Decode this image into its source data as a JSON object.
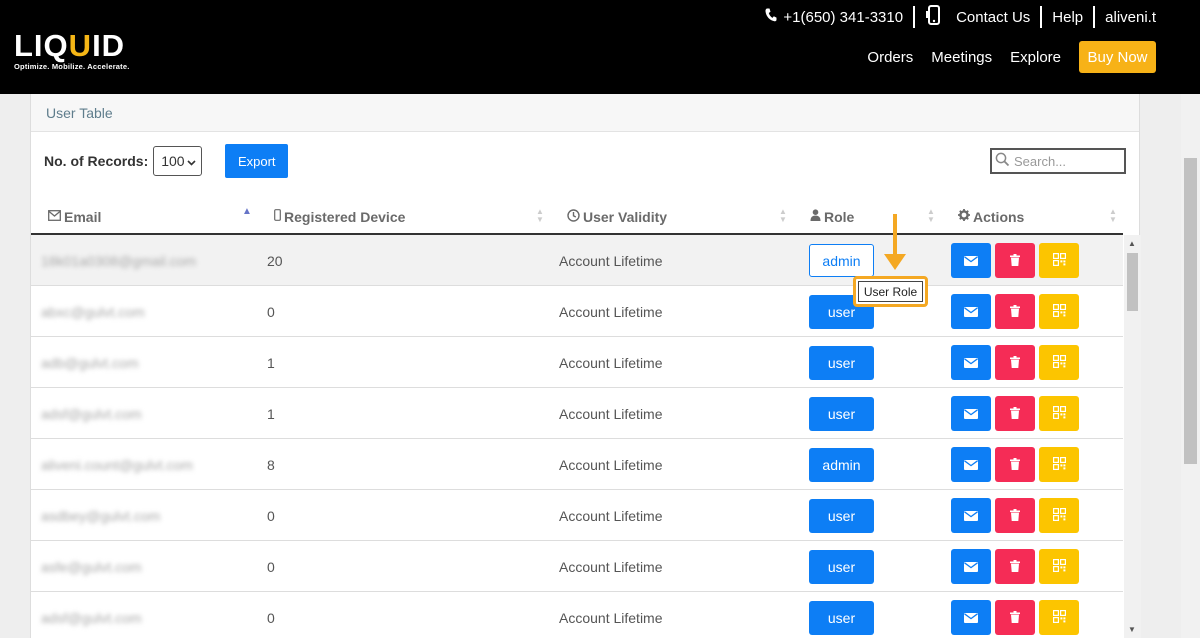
{
  "header": {
    "logo_pre": "LIQ",
    "logo_u": "U",
    "logo_post": "ID",
    "tagline": "Optimize. Mobilize. Accelerate.",
    "phone": "+1(650) 341-3310",
    "contact": "Contact Us",
    "help": "Help",
    "user": "aliveni.t",
    "nav": {
      "orders": "Orders",
      "meetings": "Meetings",
      "explore": "Explore",
      "buy_now": "Buy Now"
    }
  },
  "card": {
    "title": "User Table",
    "records_label": "No. of Records:",
    "records_value": "100",
    "export_label": "Export",
    "search_placeholder": "Search..."
  },
  "columns": {
    "email": "Email",
    "device": "Registered Device",
    "validity": "User Validity",
    "role": "Role",
    "actions": "Actions"
  },
  "rows": [
    {
      "email": "18k01a0308@gmail.com",
      "device": "20",
      "validity": "Account Lifetime",
      "role": "admin"
    },
    {
      "email": "abxc@gulvt.com",
      "device": "0",
      "validity": "Account Lifetime",
      "role": "user"
    },
    {
      "email": "adb@gulvt.com",
      "device": "1",
      "validity": "Account Lifetime",
      "role": "user"
    },
    {
      "email": "adsf@gulvt.com",
      "device": "1",
      "validity": "Account Lifetime",
      "role": "user"
    },
    {
      "email": "aliveni.count@gulvt.com",
      "device": "8",
      "validity": "Account Lifetime",
      "role": "admin"
    },
    {
      "email": "asdbey@gulvt.com",
      "device": "0",
      "validity": "Account Lifetime",
      "role": "user"
    },
    {
      "email": "asfe@gulvt.com",
      "device": "0",
      "validity": "Account Lifetime",
      "role": "user"
    },
    {
      "email": "adsf@gulvt.com",
      "device": "0",
      "validity": "Account Lifetime",
      "role": "user"
    }
  ],
  "tooltip": "User Role",
  "colors": {
    "primary": "#0d7ef5",
    "danger": "#f52c56",
    "warning": "#fcc500",
    "brand_yellow": "#f7b217",
    "annotation": "#f4a823"
  }
}
